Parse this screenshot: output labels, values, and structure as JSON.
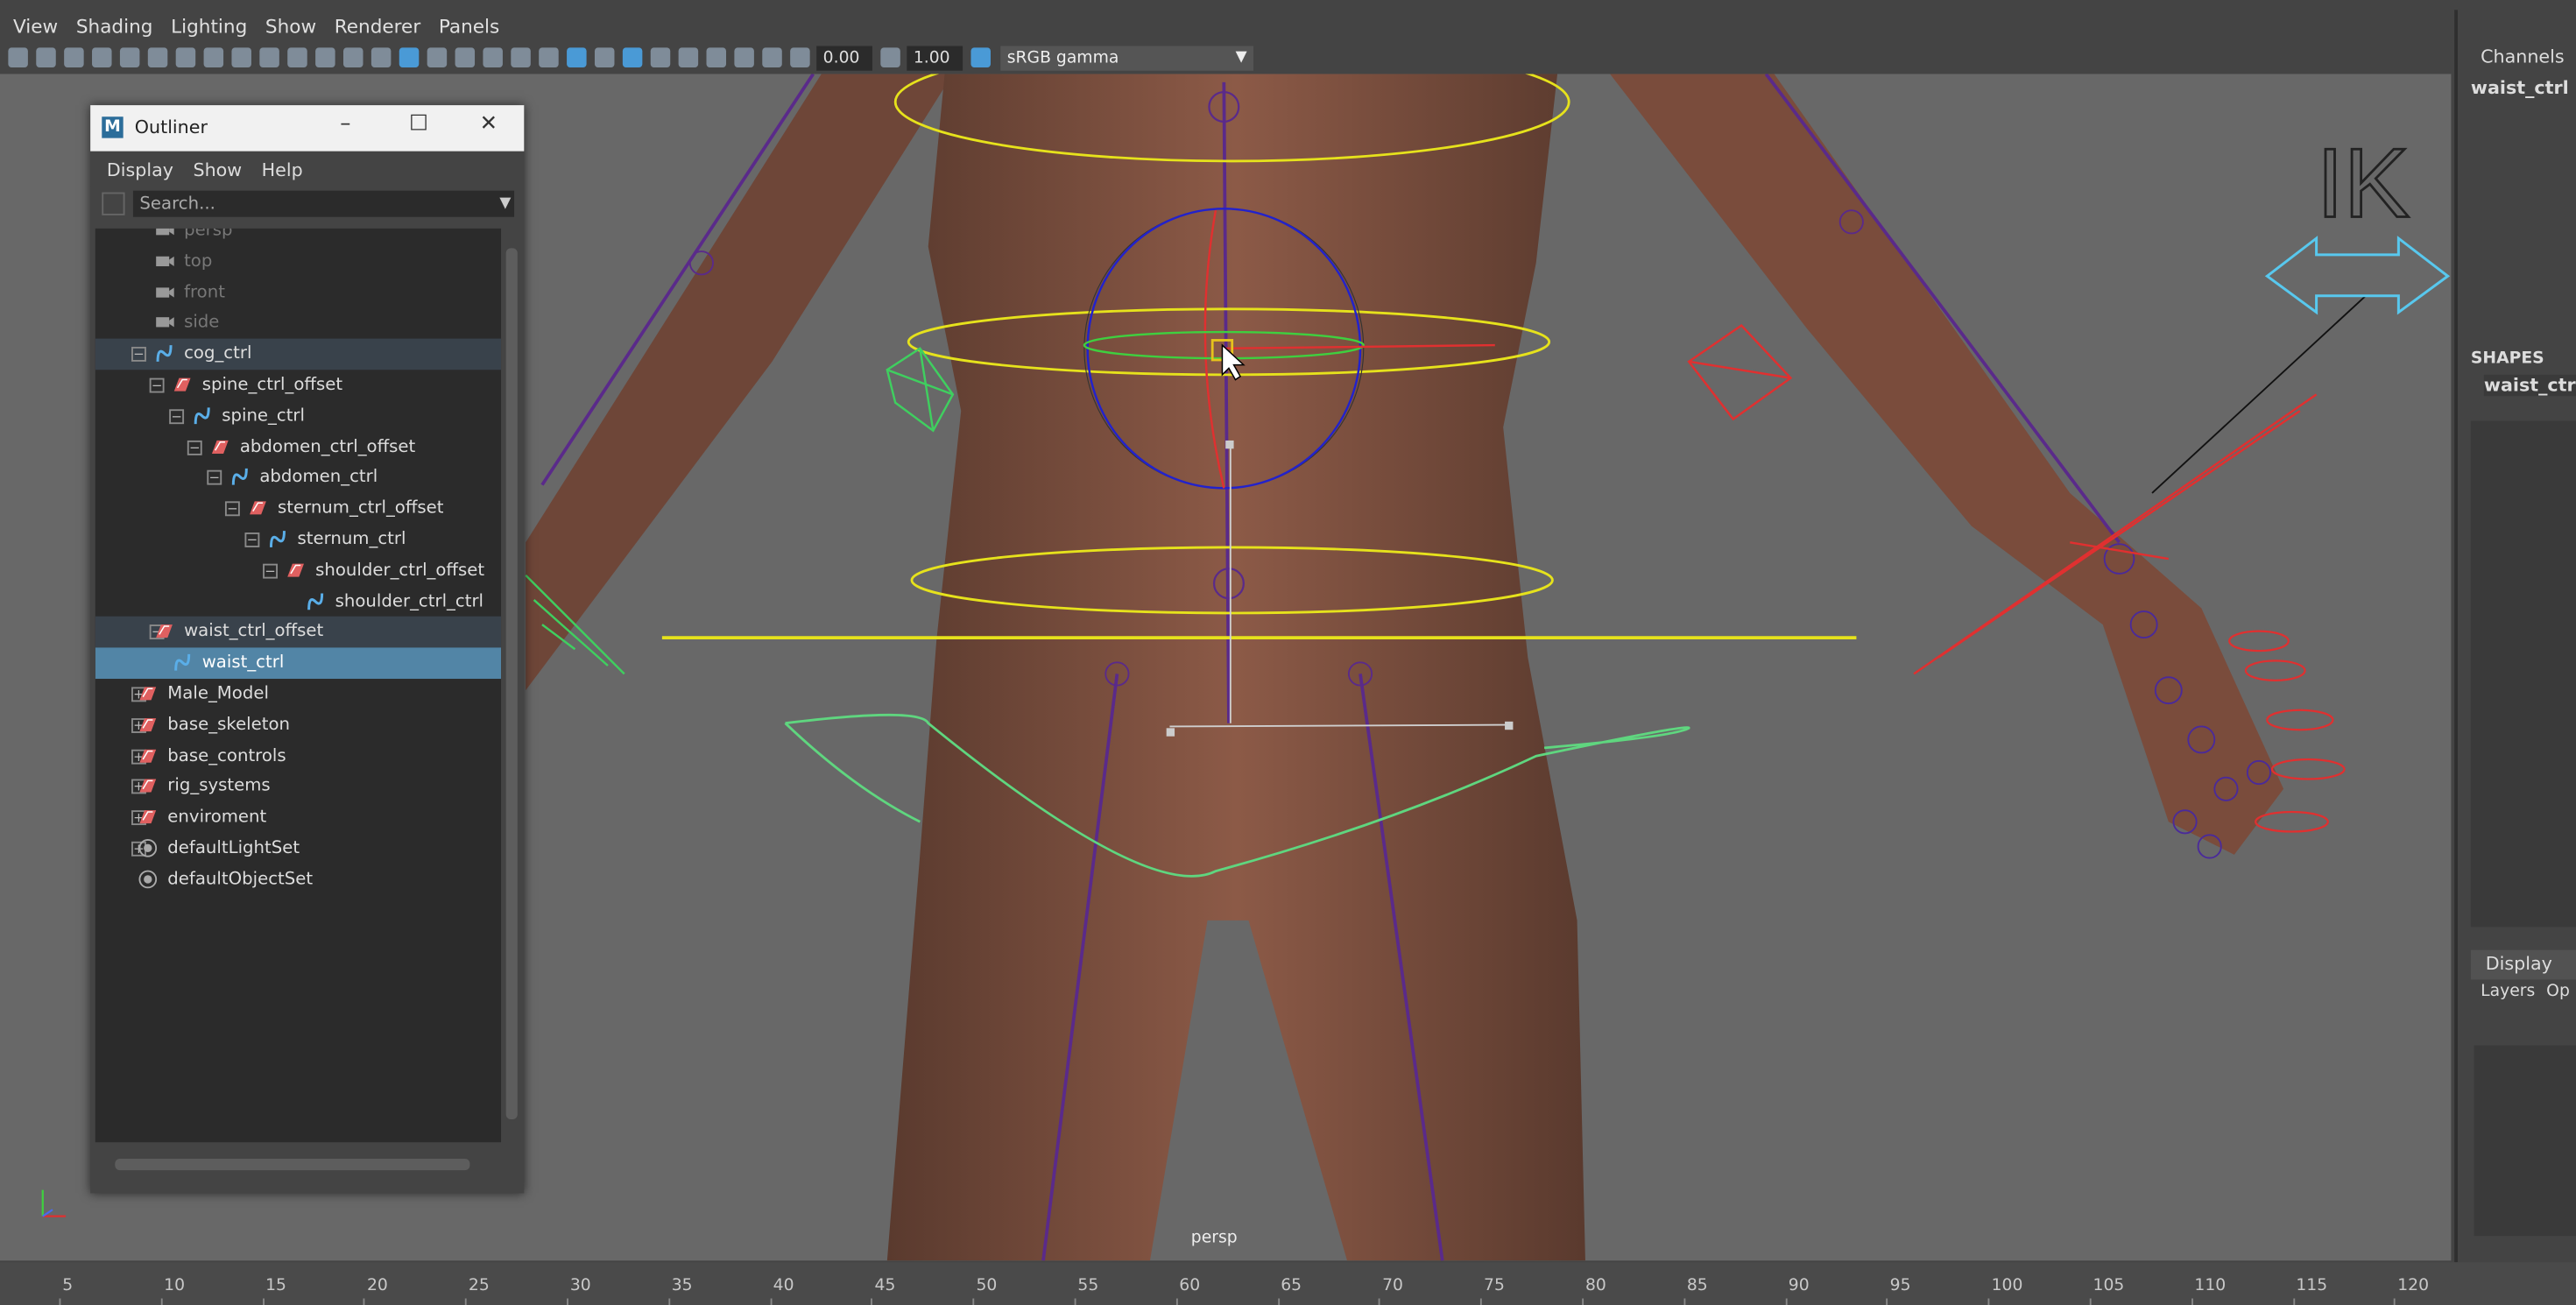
{
  "menubar": [
    "View",
    "Shading",
    "Lighting",
    "Show",
    "Renderer",
    "Panels"
  ],
  "toolbar": {
    "exposure": "0.00",
    "gamma": "1.00",
    "color_space": "sRGB gamma"
  },
  "viewport": {
    "camera_label": "persp",
    "ik_label": "IK"
  },
  "outliner": {
    "title": "Outliner",
    "menus": [
      "Display",
      "Show",
      "Help"
    ],
    "search_placeholder": "Search...",
    "items": [
      {
        "label": "persp"
      },
      {
        "label": "top"
      },
      {
        "label": "front"
      },
      {
        "label": "side"
      },
      {
        "label": "cog_ctrl"
      },
      {
        "label": "spine_ctrl_offset"
      },
      {
        "label": "spine_ctrl"
      },
      {
        "label": "abdomen_ctrl_offset"
      },
      {
        "label": "abdomen_ctrl"
      },
      {
        "label": "sternum_ctrl_offset"
      },
      {
        "label": "sternum_ctrl"
      },
      {
        "label": "shoulder_ctrl_offset"
      },
      {
        "label": "shoulder_ctrl_ctrl"
      },
      {
        "label": "waist_ctrl_offset"
      },
      {
        "label": "waist_ctrl"
      },
      {
        "label": "Male_Model"
      },
      {
        "label": "base_skeleton"
      },
      {
        "label": "base_controls"
      },
      {
        "label": "rig_systems"
      },
      {
        "label": "enviroment"
      },
      {
        "label": "defaultLightSet"
      },
      {
        "label": "defaultObjectSet"
      }
    ]
  },
  "channel_box": {
    "header": "Channels",
    "object": "waist_ctrl",
    "shapes_header": "SHAPES",
    "shape_value": "waist_ctrlS",
    "display_tab": "Display",
    "layers_label": "Layers",
    "options_label": "Op"
  },
  "timeline": {
    "ticks": [
      "5",
      "10",
      "15",
      "20",
      "25",
      "30",
      "35",
      "40",
      "45",
      "50",
      "55",
      "60",
      "65",
      "70",
      "75",
      "80",
      "85",
      "90",
      "95",
      "100",
      "105",
      "110",
      "115",
      "120"
    ]
  },
  "colors": {
    "selection": "#5285a6",
    "viewport": "#686868",
    "curve_yellow": "#e6e21c",
    "curve_green": "#5fd67f",
    "curve_red": "#e03030",
    "ik_blue": "#58c8ee"
  }
}
